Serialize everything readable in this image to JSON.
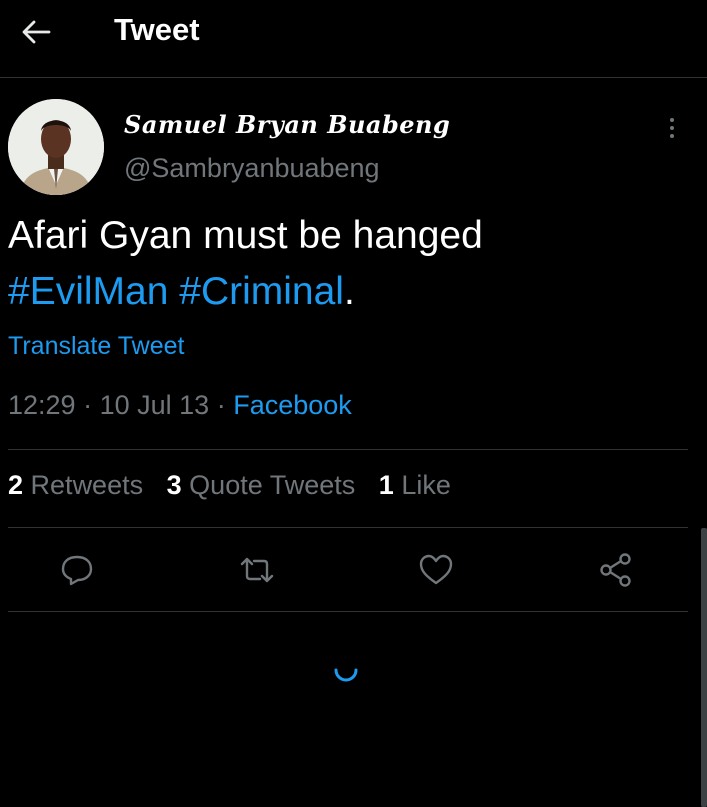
{
  "header": {
    "title": "Tweet",
    "back_icon": "arrow-left-icon"
  },
  "author": {
    "display_name": "Samuel Bryan Buabeng",
    "handle": "@Sambryanbuabeng",
    "avatar_icon": "user-avatar"
  },
  "tweet": {
    "text_plain": "Afari Gyan must be hanged",
    "hashtag_1": "#EvilMan",
    "hashtag_2": "#Criminal",
    "trailing": ".",
    "translate_label": "Translate Tweet",
    "time": "12:29",
    "date": "10 Jul 13",
    "separator": "·",
    "source": "Facebook"
  },
  "stats": {
    "retweets_count": "2",
    "retweets_label": "Retweets",
    "quotes_count": "3",
    "quotes_label": "Quote Tweets",
    "likes_count": "1",
    "likes_label": "Like"
  },
  "actions": [
    "reply-icon",
    "retweet-icon",
    "like-icon",
    "share-icon"
  ],
  "colors": {
    "background": "#000000",
    "accent": "#1d9bf0",
    "muted": "#71767b",
    "divider": "#2f3336"
  }
}
